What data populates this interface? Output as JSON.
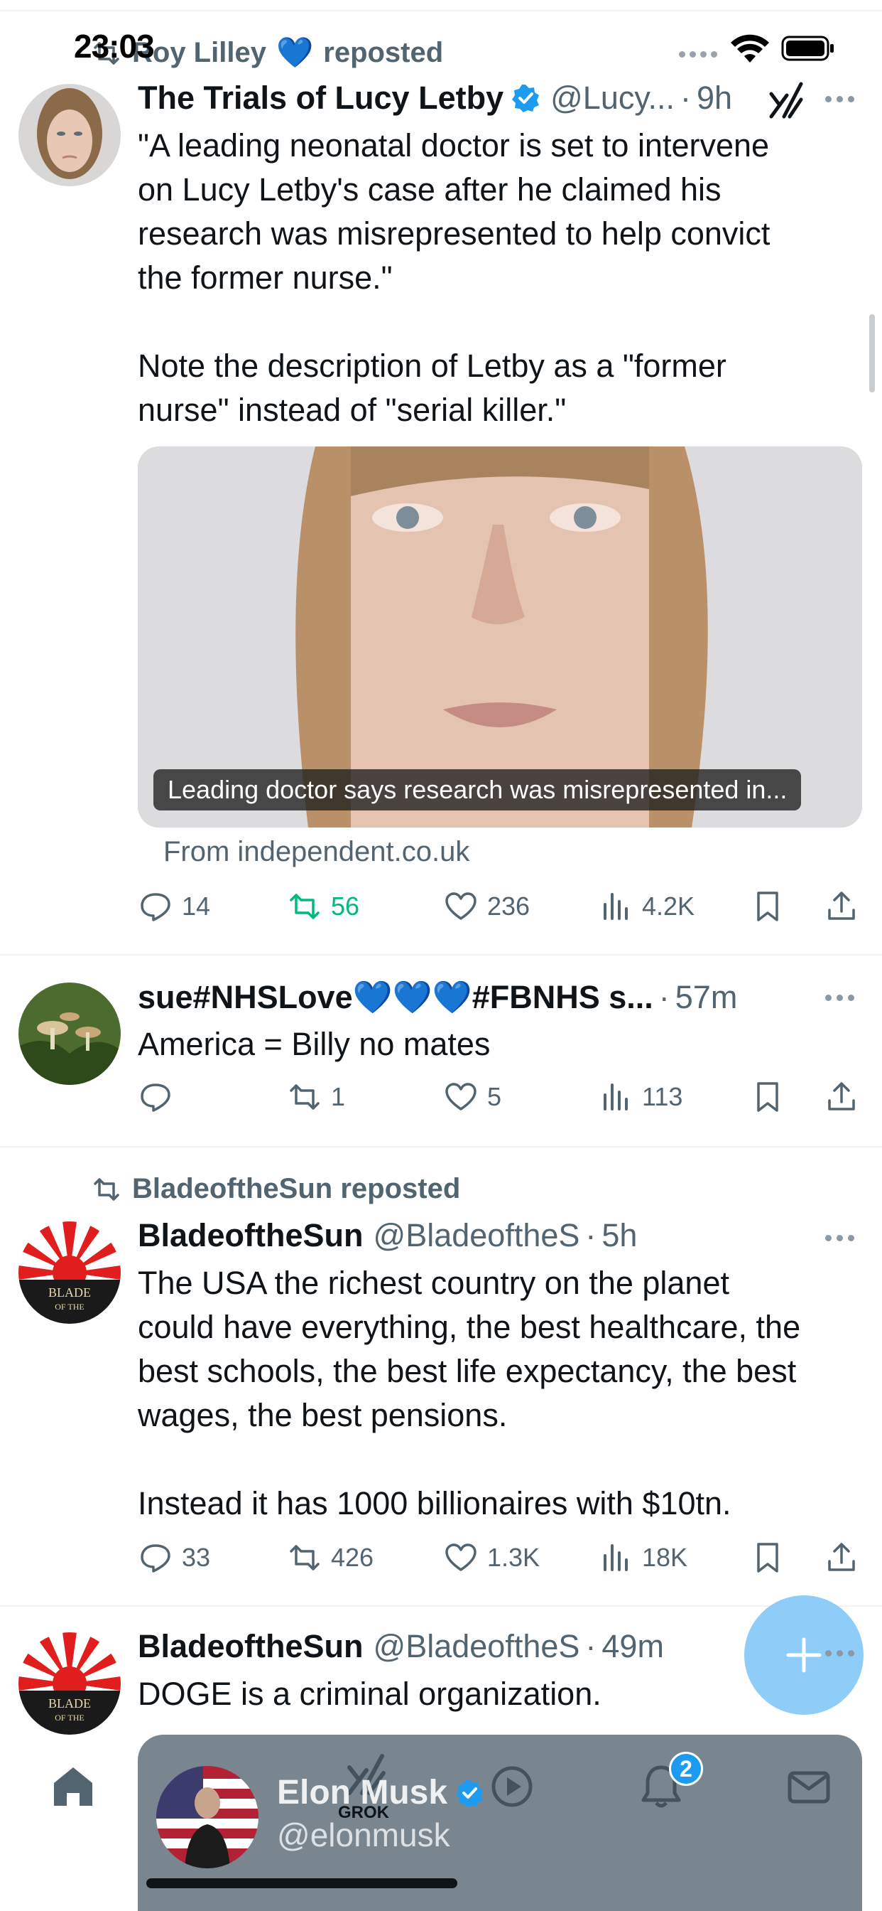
{
  "status_bar": {
    "time": "23:03"
  },
  "feed": [
    {
      "repost_by": "Roy Lilley",
      "repost_suffix": "reposted",
      "display_name": "The Trials of Lucy Letby",
      "verified": true,
      "handle": "@Lucy...",
      "time": "9h",
      "text_lines": [
        "\"A leading neonatal doctor is set to intervene",
        "on Lucy Letby's case after he claimed his",
        "research was misrepresented to help convict",
        "the former nurse.\""
      ],
      "text_lines_2": [
        "Note the description of Letby as a \"former",
        "nurse\" instead of \"serial killer.\""
      ],
      "media_caption": "Leading doctor says research was misrepresented in...",
      "source": "From independent.co.uk",
      "replies": "14",
      "reposts": "56",
      "likes": "236",
      "views": "4.2K"
    },
    {
      "display_name_a": "sue#NHSLove",
      "display_name_hearts": "💙💙💙",
      "display_name_b": "#FBNHS s...",
      "time": "57m",
      "text": "America = Billy no mates",
      "replies": "",
      "reposts": "1",
      "likes": "5",
      "views": "113"
    },
    {
      "repost_by": "BladeoftheSun reposted",
      "display_name": "BladeoftheSun",
      "handle": "@BladeoftheS",
      "time": "5h",
      "text_lines": [
        "The USA the richest country on the planet",
        "could have everything, the best healthcare, the",
        "best schools, the best life expectancy, the best",
        "wages, the best pensions."
      ],
      "text_lines_2": [
        "Instead it has 1000 billionaires with $10tn."
      ],
      "replies": "33",
      "reposts": "426",
      "likes": "1.3K",
      "views": "18K"
    },
    {
      "display_name": "BladeoftheSun",
      "handle": "@BladeoftheS",
      "time": "49m",
      "text": "DOGE is a criminal organization."
    }
  ],
  "tab_bar": {
    "grok_label": "GROK",
    "notifications_badge": "2"
  },
  "account_sheet": {
    "name": "Elon Musk",
    "handle": "@elonmusk"
  },
  "colors": {
    "accent": "#1d9bf0",
    "repost_green": "#00ba7c",
    "secondary_text": "#536471",
    "fab": "#8ecdf8"
  }
}
